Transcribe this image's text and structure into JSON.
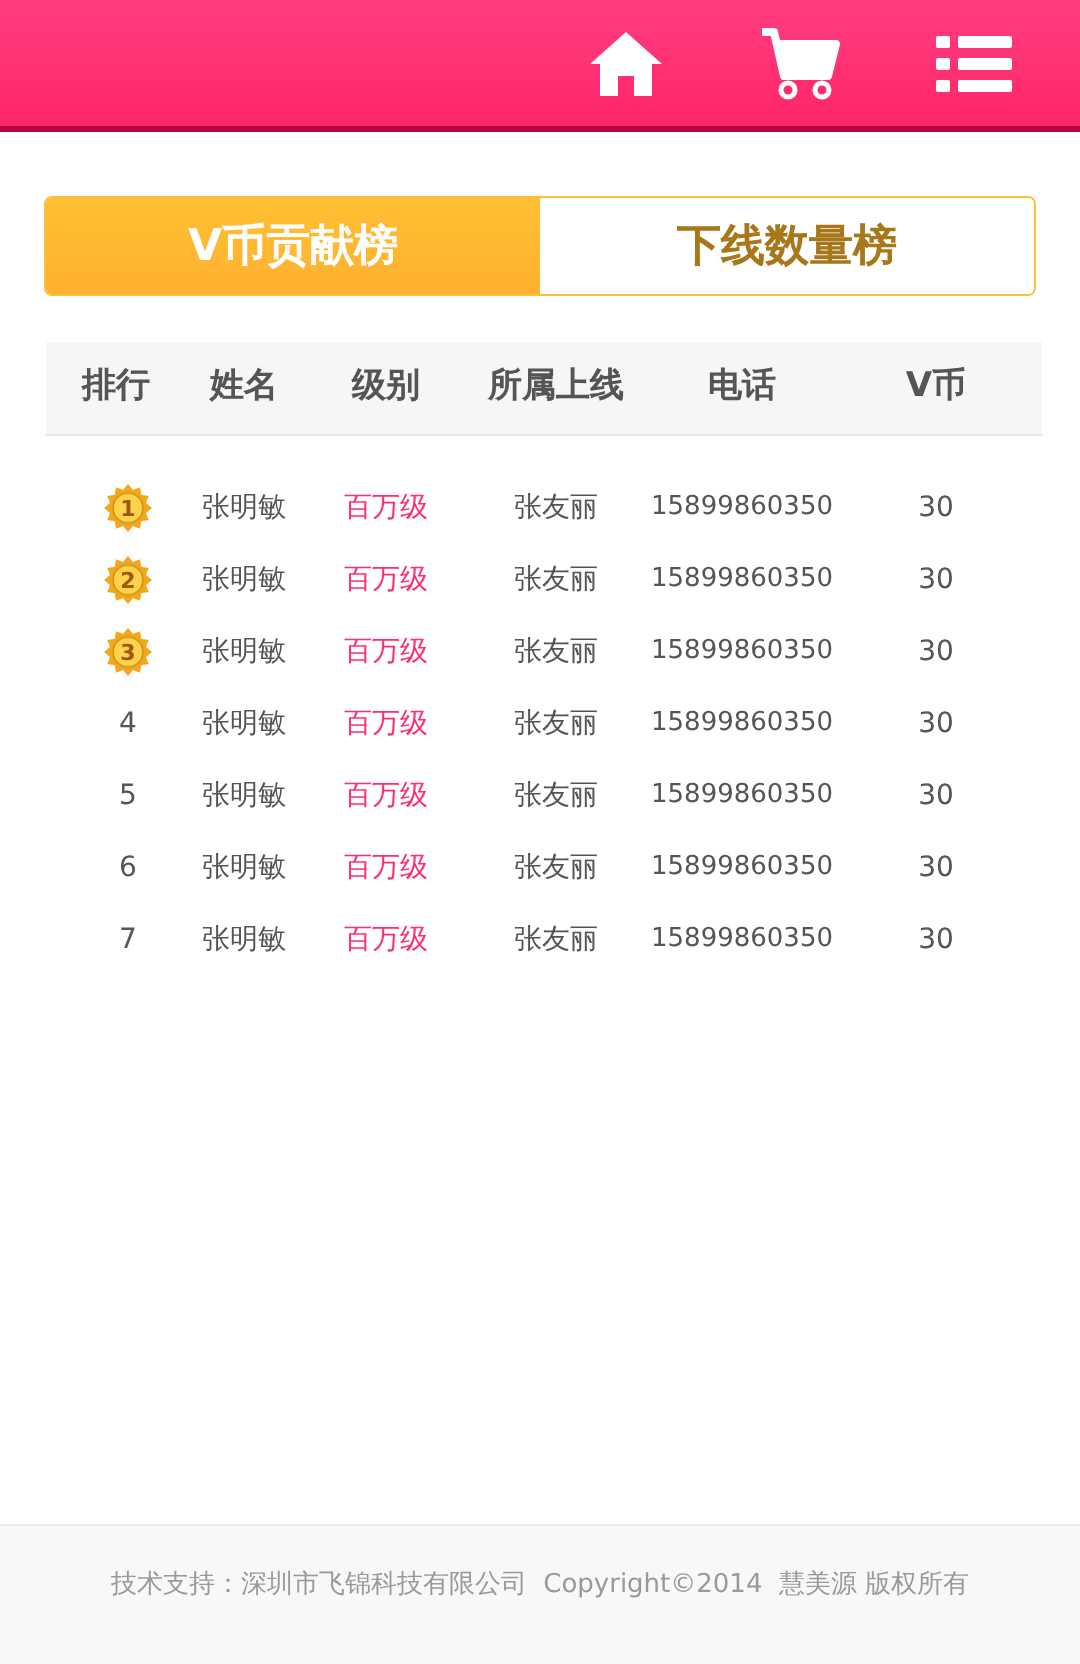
{
  "tabs": [
    {
      "label": "V币贡献榜",
      "selected": true
    },
    {
      "label": "下线数量榜",
      "selected": false
    }
  ],
  "table": {
    "columns": [
      "排行",
      "姓名",
      "级别",
      "所属上线",
      "电话",
      "V币"
    ],
    "rows": [
      {
        "rank": {
          "kind": "medal",
          "text": "1"
        },
        "name": "张明敏",
        "level": "百万级",
        "upline": "张友丽",
        "phone": "15899860350",
        "coins": "30"
      },
      {
        "rank": {
          "kind": "medal",
          "text": "2"
        },
        "name": "张明敏",
        "level": "百万级",
        "upline": "张友丽",
        "phone": "15899860350",
        "coins": "30"
      },
      {
        "rank": {
          "kind": "medal",
          "text": "3"
        },
        "name": "张明敏",
        "level": "百万级",
        "upline": "张友丽",
        "phone": "15899860350",
        "coins": "30"
      },
      {
        "rank": {
          "kind": "plain",
          "text": "4"
        },
        "name": "张明敏",
        "level": "百万级",
        "upline": "张友丽",
        "phone": "15899860350",
        "coins": "30"
      },
      {
        "rank": {
          "kind": "plain",
          "text": "5"
        },
        "name": "张明敏",
        "level": "百万级",
        "upline": "张友丽",
        "phone": "15899860350",
        "coins": "30"
      },
      {
        "rank": {
          "kind": "plain",
          "text": "6"
        },
        "name": "张明敏",
        "level": "百万级",
        "upline": "张友丽",
        "phone": "15899860350",
        "coins": "30"
      },
      {
        "rank": {
          "kind": "plain",
          "text": "7"
        },
        "name": "张明敏",
        "level": "百万级",
        "upline": "张友丽",
        "phone": "15899860350",
        "coins": "30"
      }
    ]
  },
  "footer": "技术支持：深圳市飞锦科技有限公司  Copyright©2014  慧美源 版权所有"
}
